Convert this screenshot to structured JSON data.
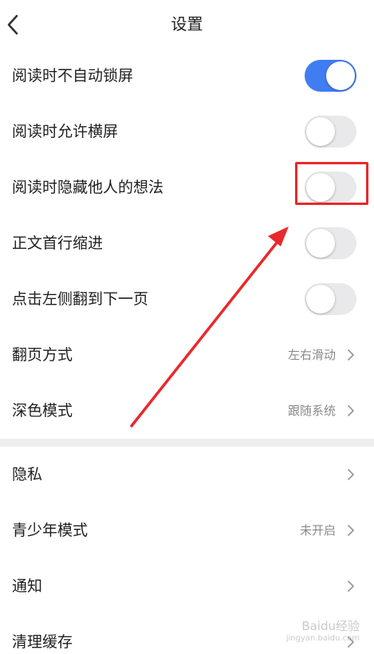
{
  "header": {
    "title": "设置",
    "back_icon": "chevron-left-icon"
  },
  "reading_settings": [
    {
      "label": "阅读时不自动锁屏",
      "type": "toggle",
      "on": true
    },
    {
      "label": "阅读时允许横屏",
      "type": "toggle",
      "on": false
    },
    {
      "label": "阅读时隐藏他人的想法",
      "type": "toggle",
      "on": false,
      "highlighted": true
    },
    {
      "label": "正文首行缩进",
      "type": "toggle",
      "on": false
    },
    {
      "label": "点击左侧翻到下一页",
      "type": "toggle",
      "on": false
    },
    {
      "label": "翻页方式",
      "type": "link",
      "value": "左右滑动"
    },
    {
      "label": "深色模式",
      "type": "link",
      "value": "跟随系统"
    }
  ],
  "general_settings": [
    {
      "label": "隐私",
      "type": "link",
      "value": ""
    },
    {
      "label": "青少年模式",
      "type": "link",
      "value": "未开启"
    },
    {
      "label": "通知",
      "type": "link",
      "value": ""
    },
    {
      "label": "清理缓存",
      "type": "link",
      "value": ""
    }
  ],
  "colors": {
    "toggle_on": "#3f7df0",
    "toggle_off": "#e9e9eb",
    "annotation_red": "#e8292c",
    "section_divider": "#eeeeef"
  },
  "watermark": {
    "text": "Baidu经验",
    "sub": "jingyan.baidu.com"
  }
}
